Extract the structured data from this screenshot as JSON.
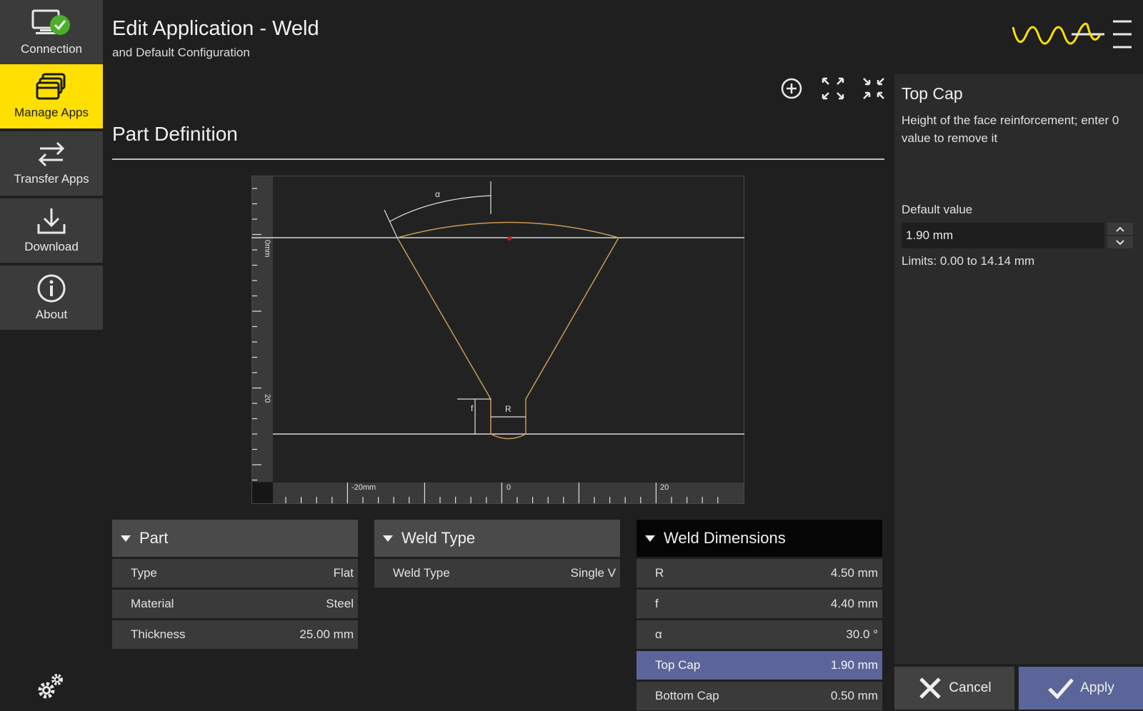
{
  "sidebar": {
    "items": [
      {
        "label": "Connection",
        "icon": "monitor-check-icon"
      },
      {
        "label": "Manage Apps",
        "icon": "stacked-windows-icon",
        "active": true
      },
      {
        "label": "Transfer Apps",
        "icon": "arrows-swap-icon"
      },
      {
        "label": "Download",
        "icon": "download-icon"
      },
      {
        "label": "About",
        "icon": "info-icon"
      }
    ],
    "settings_icon": "gears-icon"
  },
  "header": {
    "title": "Edit Application - Weld",
    "subtitle": "and Default Configuration"
  },
  "brand": {
    "accent": "#ffe000",
    "selection": "#5b6599"
  },
  "toolbar": {
    "icons": [
      "zoom-in-icon",
      "expand-icon",
      "collapse-icon"
    ]
  },
  "part_definition": {
    "title": "Part Definition",
    "drawing": {
      "ruler_x_labels": [
        "-20mm",
        "0",
        "20"
      ],
      "ruler_y_labels": [
        "0mm",
        "20"
      ],
      "dimension_labels": {
        "alpha": "α",
        "f": "f",
        "R": "R"
      }
    }
  },
  "panels": {
    "part": {
      "title": "Part",
      "rows": [
        {
          "label": "Type",
          "value": "Flat"
        },
        {
          "label": "Material",
          "value": "Steel"
        },
        {
          "label": "Thickness",
          "value": "25.00 mm"
        }
      ]
    },
    "weld_type": {
      "title": "Weld Type",
      "rows": [
        {
          "label": "Weld Type",
          "value": "Single V"
        }
      ]
    },
    "weld_dimensions": {
      "title": "Weld Dimensions",
      "rows": [
        {
          "label": "R",
          "value": "4.50 mm"
        },
        {
          "label": "f",
          "value": "4.40 mm"
        },
        {
          "label": "α",
          "value": "30.0 °"
        },
        {
          "label": "Top Cap",
          "value": "1.90 mm",
          "selected": true
        },
        {
          "label": "Bottom Cap",
          "value": "0.50 mm"
        }
      ]
    }
  },
  "details": {
    "title": "Top Cap",
    "description": "Height of the face reinforcement; enter 0 value to remove it",
    "default_label": "Default value",
    "default_value": "1.90 mm",
    "limits": "Limits: 0.00 to 14.14 mm"
  },
  "actions": {
    "cancel": "Cancel",
    "apply": "Apply"
  }
}
